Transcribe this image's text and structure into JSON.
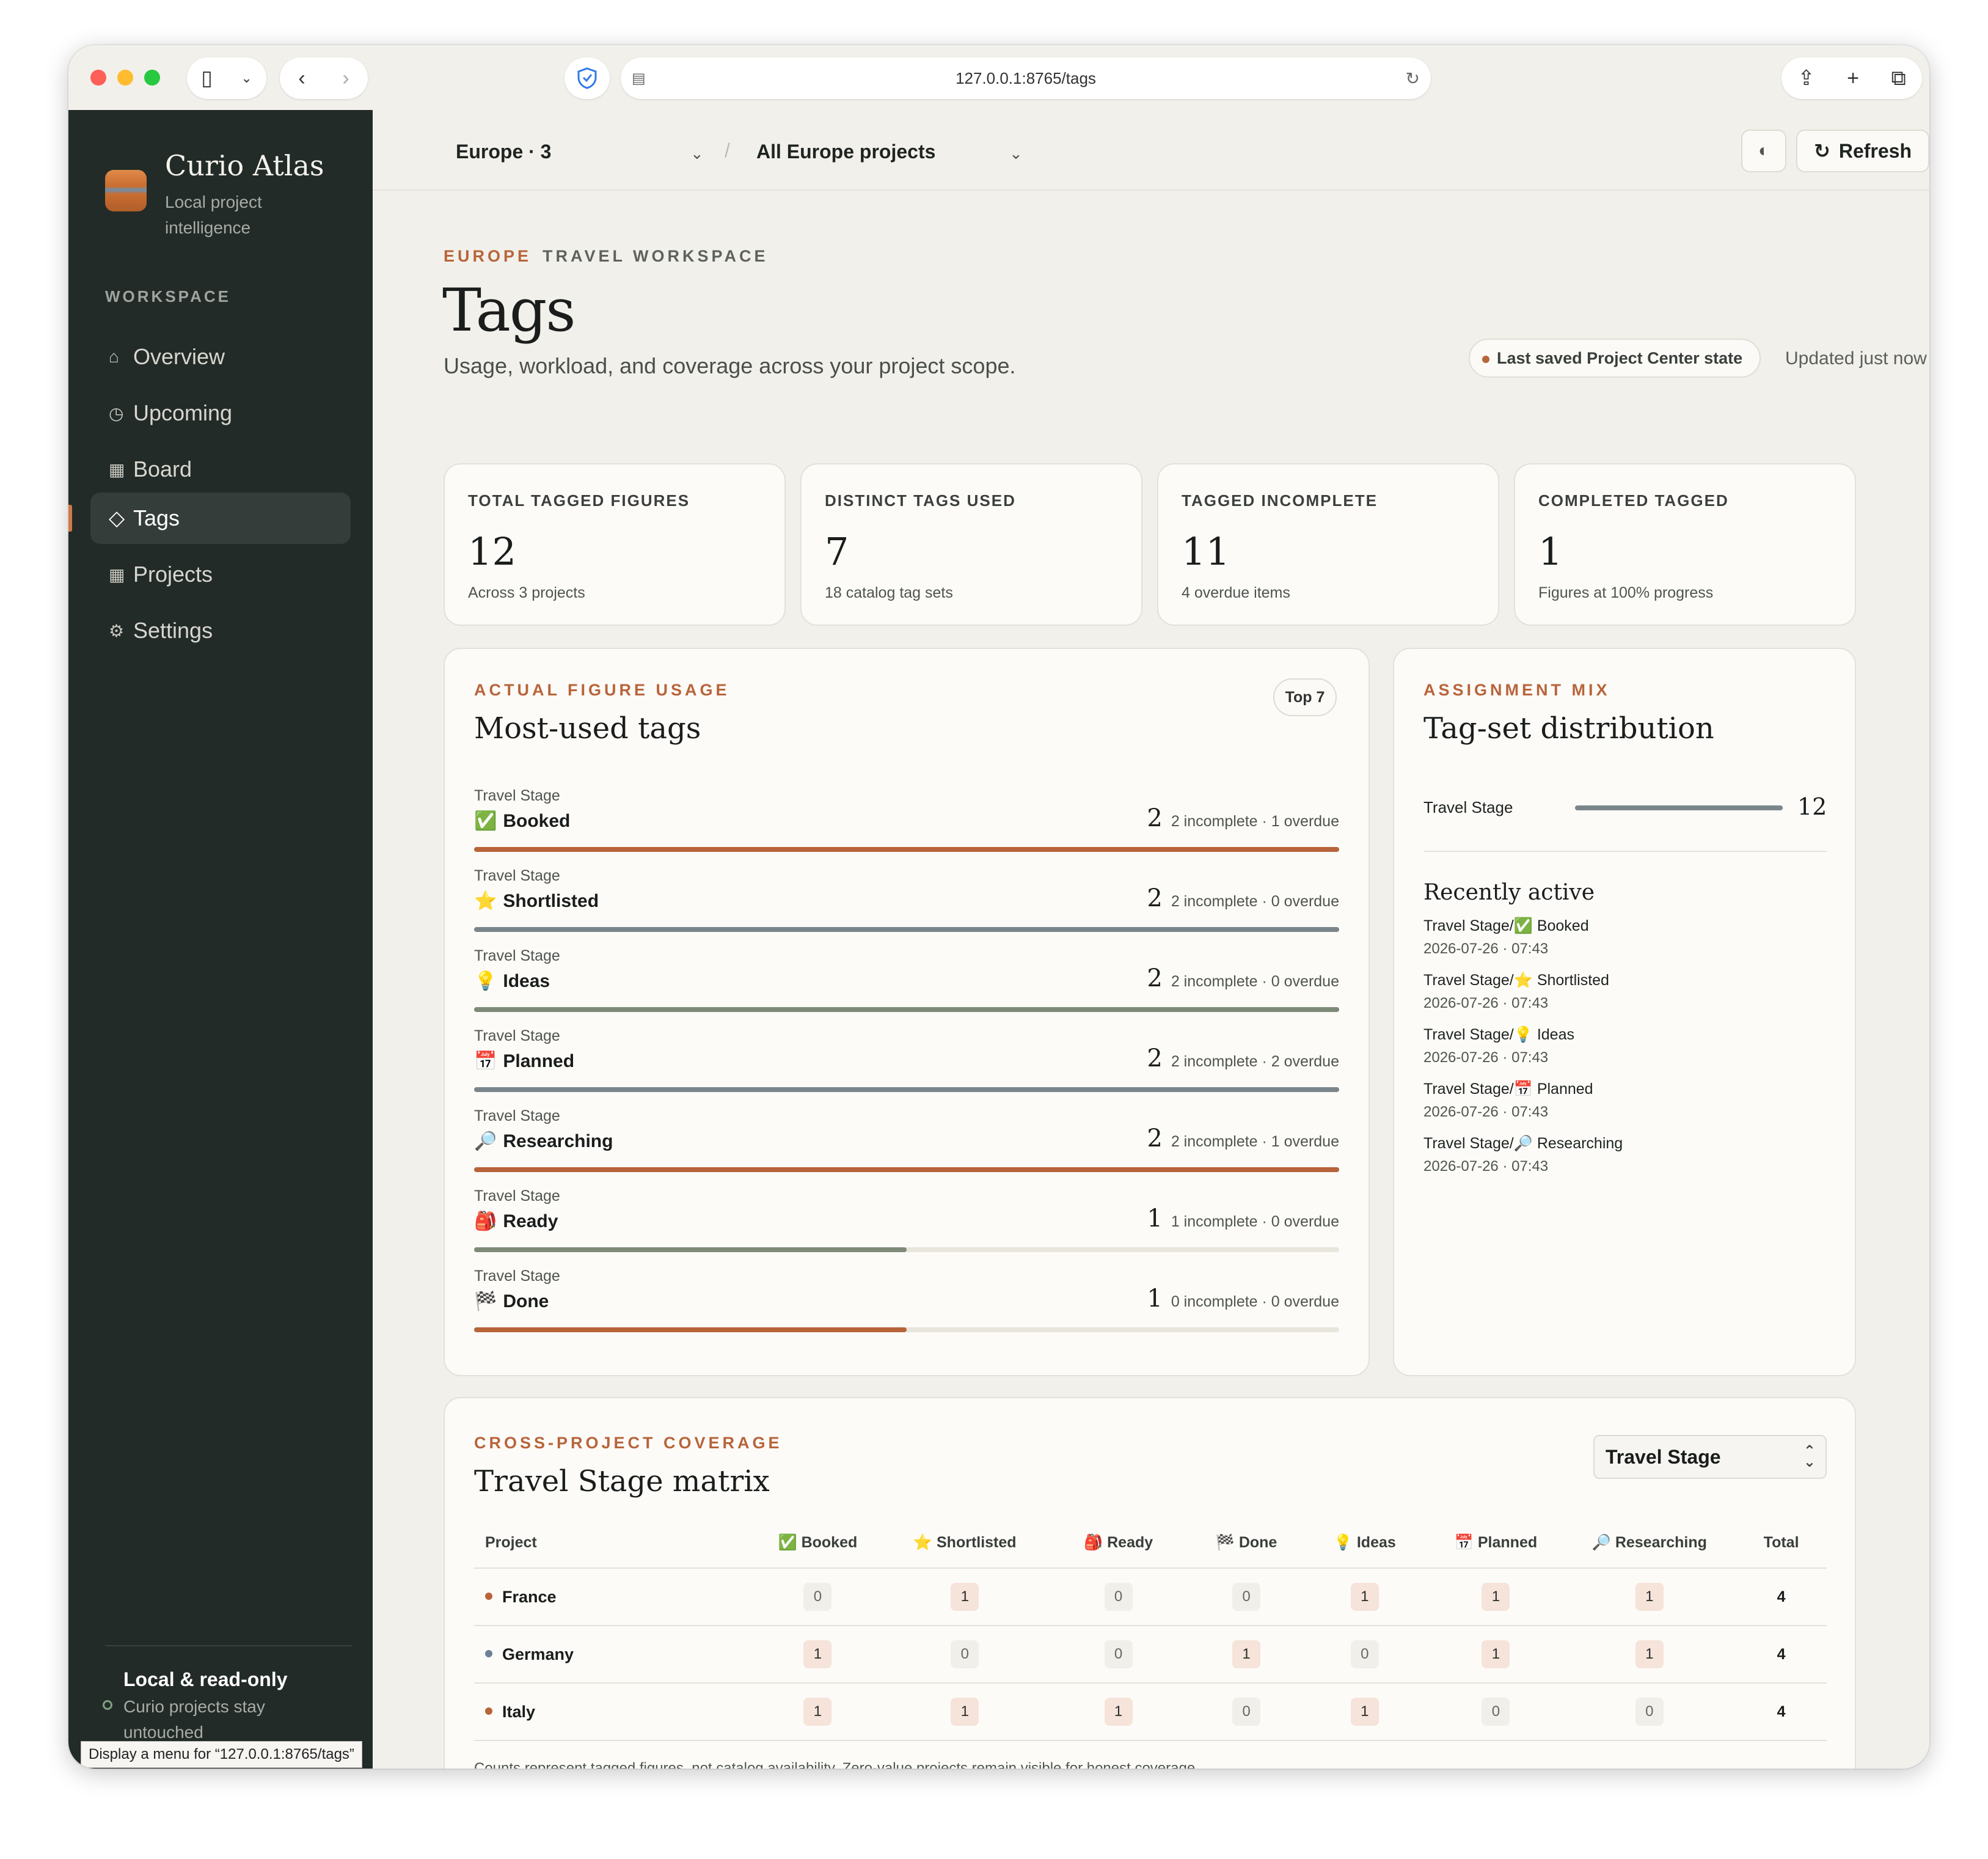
{
  "browser": {
    "url": "127.0.0.1:8765/tags",
    "status_tip": "Display a menu for “127.0.0.1:8765/tags”"
  },
  "colors": {
    "accent": "#b8643a",
    "slate": "#7a868c",
    "sage": "#7d8a78",
    "sidebar_bg": "#222b27"
  },
  "sidebar": {
    "brand_name": "Curio Atlas",
    "brand_sub": "Local project intelligence",
    "section_label": "WORKSPACE",
    "items": [
      {
        "label": "Overview",
        "icon": "home-icon",
        "glyph": "⌂"
      },
      {
        "label": "Upcoming",
        "icon": "clock-icon",
        "glyph": "◷"
      },
      {
        "label": "Board",
        "icon": "board-icon",
        "glyph": "▦"
      },
      {
        "label": "Tags",
        "icon": "tag-icon",
        "glyph": "◇"
      },
      {
        "label": "Projects",
        "icon": "projects-icon",
        "glyph": "▦"
      },
      {
        "label": "Settings",
        "icon": "gear-icon",
        "glyph": "⚙"
      }
    ],
    "active": "Tags",
    "footer_title": "Local & read-only",
    "footer_sub": "Curio projects stay untouched"
  },
  "topbar": {
    "scope": "Europe · 3",
    "project_filter": "All Europe projects",
    "refresh_label": "Refresh"
  },
  "header": {
    "eyebrow_scope": "EUROPE",
    "eyebrow_workspace": "TRAVEL WORKSPACE",
    "title": "Tags",
    "subtitle": "Usage, workload, and coverage across your project scope.",
    "saved_state": "Last saved Project Center state",
    "updated": "Updated just now"
  },
  "stats": [
    {
      "label": "TOTAL TAGGED FIGURES",
      "value": "12",
      "sub": "Across 3 projects"
    },
    {
      "label": "DISTINCT TAGS USED",
      "value": "7",
      "sub": "18 catalog tag sets"
    },
    {
      "label": "TAGGED INCOMPLETE",
      "value": "11",
      "sub": "4 overdue items"
    },
    {
      "label": "COMPLETED TAGGED",
      "value": "1",
      "sub": "Figures at 100% progress"
    }
  ],
  "usage": {
    "eyebrow": "ACTUAL FIGURE USAGE",
    "title": "Most-used tags",
    "badge": "Top 7",
    "max": 2,
    "rows": [
      {
        "group": "Travel Stage",
        "emoji": "✅",
        "name": "Booked",
        "count": 2,
        "detail": "2 incomplete · 1 overdue",
        "color": "#b8643a"
      },
      {
        "group": "Travel Stage",
        "emoji": "⭐",
        "name": "Shortlisted",
        "count": 2,
        "detail": "2 incomplete · 0 overdue",
        "color": "#7a868c"
      },
      {
        "group": "Travel Stage",
        "emoji": "💡",
        "name": "Ideas",
        "count": 2,
        "detail": "2 incomplete · 0 overdue",
        "color": "#7d8a78"
      },
      {
        "group": "Travel Stage",
        "emoji": "📅",
        "name": "Planned",
        "count": 2,
        "detail": "2 incomplete · 2 overdue",
        "color": "#7a868c"
      },
      {
        "group": "Travel Stage",
        "emoji": "🔎",
        "name": "Researching",
        "count": 2,
        "detail": "2 incomplete · 1 overdue",
        "color": "#b8643a"
      },
      {
        "group": "Travel Stage",
        "emoji": "🎒",
        "name": "Ready",
        "count": 1,
        "detail": "1 incomplete · 0 overdue",
        "color": "#7d8a78"
      },
      {
        "group": "Travel Stage",
        "emoji": "🏁",
        "name": "Done",
        "count": 1,
        "detail": "0 incomplete · 0 overdue",
        "color": "#b8643a"
      }
    ]
  },
  "assignment": {
    "eyebrow": "ASSIGNMENT MIX",
    "title": "Tag-set distribution",
    "distribution": [
      {
        "name": "Travel Stage",
        "value": 12,
        "fraction": 1.0
      }
    ],
    "recent_title": "Recently active",
    "recent": [
      {
        "label": "Travel Stage/✅ Booked",
        "time": "2026-07-26 · 07:43"
      },
      {
        "label": "Travel Stage/⭐ Shortlisted",
        "time": "2026-07-26 · 07:43"
      },
      {
        "label": "Travel Stage/💡 Ideas",
        "time": "2026-07-26 · 07:43"
      },
      {
        "label": "Travel Stage/📅 Planned",
        "time": "2026-07-26 · 07:43"
      },
      {
        "label": "Travel Stage/🔎 Researching",
        "time": "2026-07-26 · 07:43"
      }
    ]
  },
  "coverage": {
    "eyebrow": "CROSS-PROJECT COVERAGE",
    "title": "Travel Stage matrix",
    "select_value": "Travel Stage",
    "columns": [
      "Project",
      "✅ Booked",
      "⭐ Shortlisted",
      "🎒 Ready",
      "🏁 Done",
      "💡 Ideas",
      "📅 Planned",
      "🔎 Researching",
      "Total"
    ],
    "rows": [
      {
        "project": "France",
        "dot": "#b8643a",
        "values": [
          0,
          1,
          0,
          0,
          1,
          1,
          1
        ],
        "total": 4
      },
      {
        "project": "Germany",
        "dot": "#6f8196",
        "values": [
          1,
          0,
          0,
          1,
          0,
          1,
          1
        ],
        "total": 4
      },
      {
        "project": "Italy",
        "dot": "#b8643a",
        "values": [
          1,
          1,
          1,
          0,
          1,
          0,
          0
        ],
        "total": 4
      }
    ],
    "note": "Counts represent tagged figures, not catalog availability. Zero-value projects remain visible for honest coverage."
  }
}
